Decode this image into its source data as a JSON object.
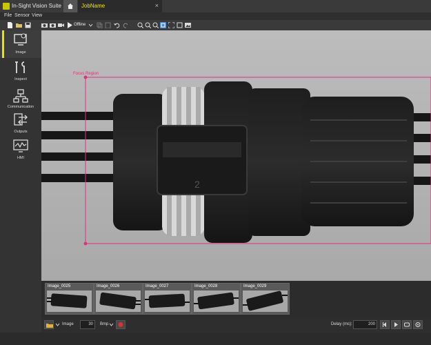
{
  "app": {
    "title": "In-Sight Vision Suite"
  },
  "tabs": {
    "job_name": "JobName",
    "close_glyph": "×"
  },
  "menu": {
    "file": "File",
    "sensor": "Sensor",
    "view": "View"
  },
  "toolbar": {
    "offline_label": "Offline"
  },
  "sidebar": {
    "items": [
      {
        "label": "Image",
        "icon": "image-settings-icon",
        "active": true
      },
      {
        "label": "Inspect",
        "icon": "tools-icon",
        "active": false
      },
      {
        "label": "Communication",
        "icon": "network-icon",
        "active": false
      },
      {
        "label": "Outputs",
        "icon": "outputs-icon",
        "active": false
      },
      {
        "label": "HMI",
        "icon": "hmi-monitor-icon",
        "active": false
      }
    ]
  },
  "viewer": {
    "focus_region_label": "Focus Region",
    "part_marking": "2"
  },
  "filmstrip": {
    "thumbnails": [
      {
        "label": "Image_0025"
      },
      {
        "label": "Image_0026"
      },
      {
        "label": "Image_0027"
      },
      {
        "label": "Image_0028"
      },
      {
        "label": "Image_0029"
      }
    ]
  },
  "bottombar": {
    "source_value": "Image",
    "count_value": "30",
    "format_value": "Bmp",
    "delay_label": "Delay (ms):",
    "delay_value": "200"
  },
  "colors": {
    "accent": "#e6e600",
    "focus_region": "#e0307a",
    "record": "#d33333"
  }
}
